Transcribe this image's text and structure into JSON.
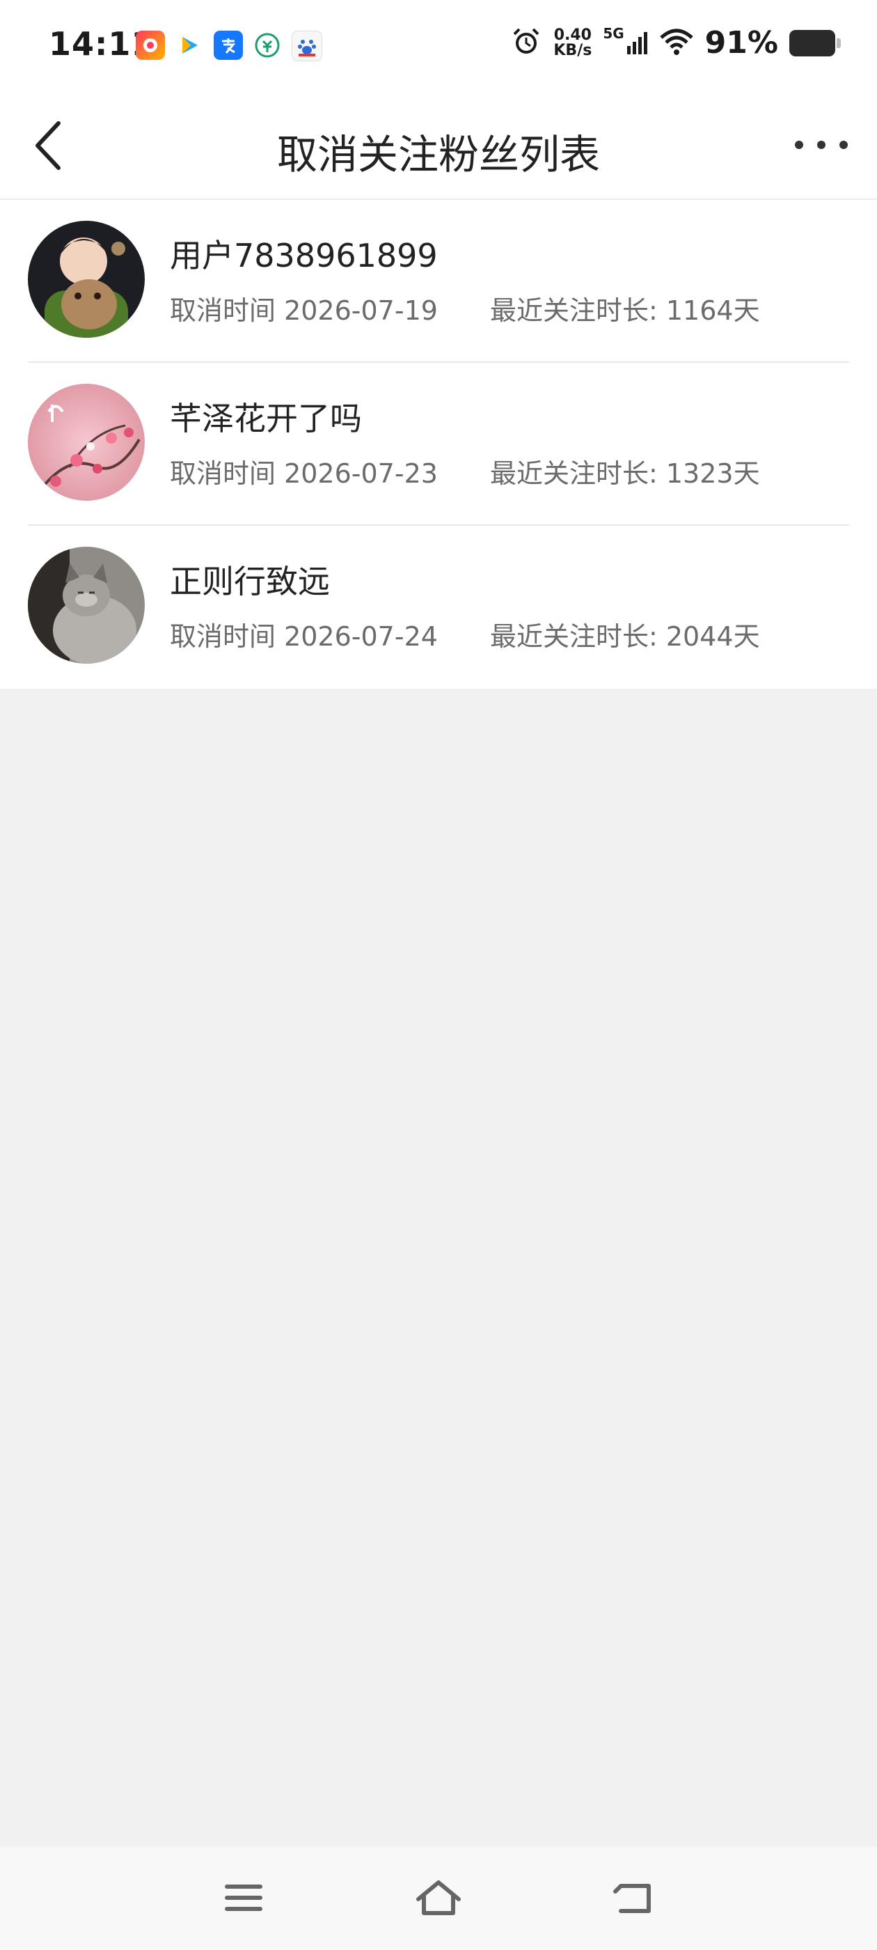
{
  "status_bar": {
    "time": "14:11",
    "net_speed_value": "0.40",
    "net_speed_unit": "KB/s",
    "network_type": "5G",
    "battery_percent": "91%",
    "notification_icons": [
      "shopping-app-icon",
      "video-app-icon",
      "alipay-icon",
      "bank-app-icon",
      "baidu-icon"
    ]
  },
  "header": {
    "title": "取消关注粉丝列表"
  },
  "list": {
    "items": [
      {
        "name": "用户7838961899",
        "cancel_time": "取消时间 2026-07-19",
        "duration": "最近关注时长: 1164天"
      },
      {
        "name": "芊泽花开了吗",
        "cancel_time": "取消时间 2026-07-23",
        "duration": "最近关注时长: 1323天"
      },
      {
        "name": "正则行致远",
        "cancel_time": "取消时间 2026-07-24",
        "duration": "最近关注时长: 2044天"
      }
    ]
  },
  "colors": {
    "background": "#f1f1f1",
    "surface": "#ffffff",
    "text_primary": "#222222",
    "text_secondary": "#6b6b6b"
  }
}
